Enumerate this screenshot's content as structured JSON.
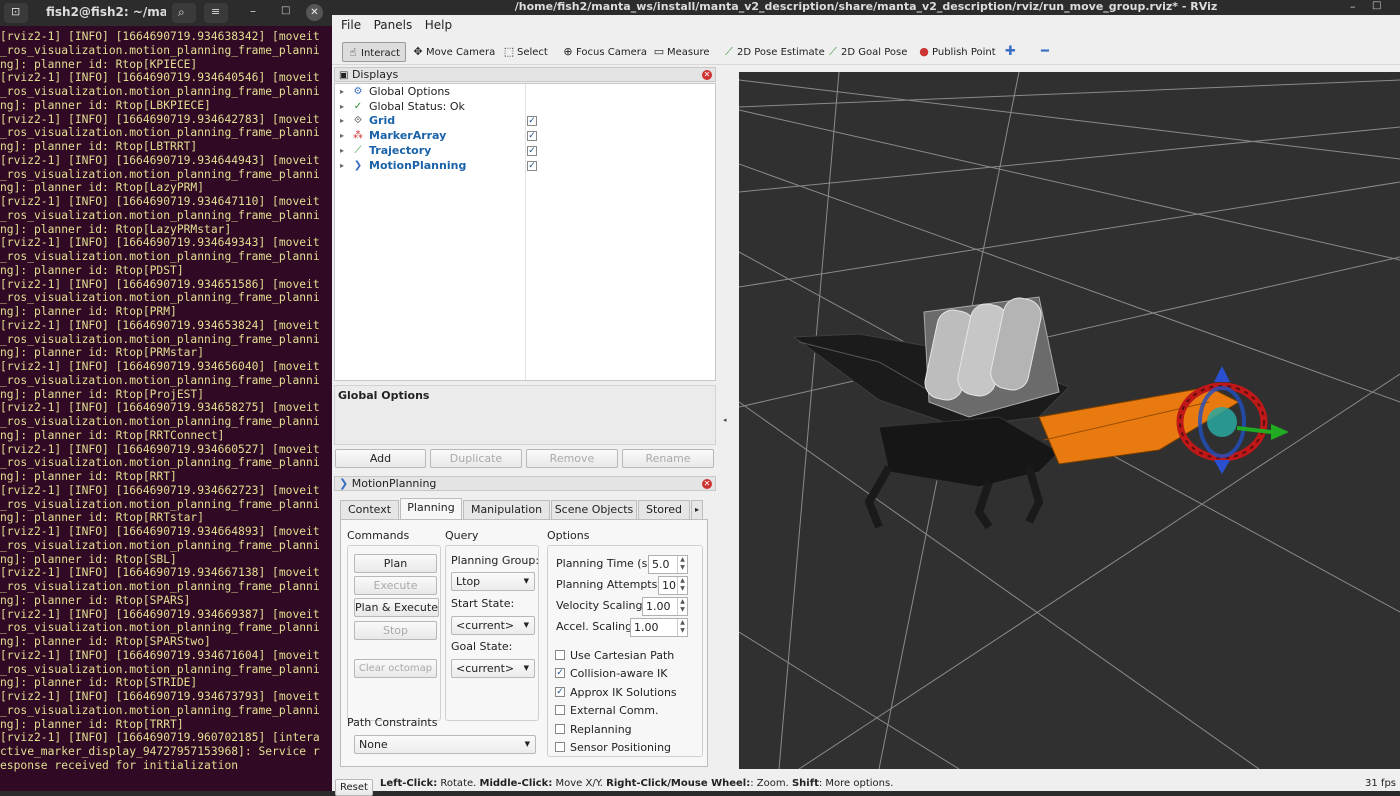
{
  "terminal": {
    "title": "fish2@fish2: ~/ma...",
    "lines": [
      "[rviz2-1] [INFO] [1664690719.934638342] [moveit",
      "_ros_visualization.motion_planning_frame_planni",
      "ng]: planner id: Rtop[KPIECE]",
      "[rviz2-1] [INFO] [1664690719.934640546] [moveit",
      "_ros_visualization.motion_planning_frame_planni",
      "ng]: planner id: Rtop[LBKPIECE]",
      "[rviz2-1] [INFO] [1664690719.934642783] [moveit",
      "_ros_visualization.motion_planning_frame_planni",
      "ng]: planner id: Rtop[LBTRRT]",
      "[rviz2-1] [INFO] [1664690719.934644943] [moveit",
      "_ros_visualization.motion_planning_frame_planni",
      "ng]: planner id: Rtop[LazyPRM]",
      "[rviz2-1] [INFO] [1664690719.934647110] [moveit",
      "_ros_visualization.motion_planning_frame_planni",
      "ng]: planner id: Rtop[LazyPRMstar]",
      "[rviz2-1] [INFO] [1664690719.934649343] [moveit",
      "_ros_visualization.motion_planning_frame_planni",
      "ng]: planner id: Rtop[PDST]",
      "[rviz2-1] [INFO] [1664690719.934651586] [moveit",
      "_ros_visualization.motion_planning_frame_planni",
      "ng]: planner id: Rtop[PRM]",
      "[rviz2-1] [INFO] [1664690719.934653824] [moveit",
      "_ros_visualization.motion_planning_frame_planni",
      "ng]: planner id: Rtop[PRMstar]",
      "[rviz2-1] [INFO] [1664690719.934656040] [moveit",
      "_ros_visualization.motion_planning_frame_planni",
      "ng]: planner id: Rtop[ProjEST]",
      "[rviz2-1] [INFO] [1664690719.934658275] [moveit",
      "_ros_visualization.motion_planning_frame_planni",
      "ng]: planner id: Rtop[RRTConnect]",
      "[rviz2-1] [INFO] [1664690719.934660527] [moveit",
      "_ros_visualization.motion_planning_frame_planni",
      "ng]: planner id: Rtop[RRT]",
      "[rviz2-1] [INFO] [1664690719.934662723] [moveit",
      "_ros_visualization.motion_planning_frame_planni",
      "ng]: planner id: Rtop[RRTstar]",
      "[rviz2-1] [INFO] [1664690719.934664893] [moveit",
      "_ros_visualization.motion_planning_frame_planni",
      "ng]: planner id: Rtop[SBL]",
      "[rviz2-1] [INFO] [1664690719.934667138] [moveit",
      "_ros_visualization.motion_planning_frame_planni",
      "ng]: planner id: Rtop[SPARS]",
      "[rviz2-1] [INFO] [1664690719.934669387] [moveit",
      "_ros_visualization.motion_planning_frame_planni",
      "ng]: planner id: Rtop[SPARStwo]",
      "[rviz2-1] [INFO] [1664690719.934671604] [moveit",
      "_ros_visualization.motion_planning_frame_planni",
      "ng]: planner id: Rtop[STRIDE]",
      "[rviz2-1] [INFO] [1664690719.934673793] [moveit",
      "_ros_visualization.motion_planning_frame_planni",
      "ng]: planner id: Rtop[TRRT]",
      "[rviz2-1] [INFO] [1664690719.960702185] [intera",
      "ctive_marker_display_94727957153968]: Service r",
      "esponse received for initialization"
    ]
  },
  "window": {
    "title": "/home/fish2/manta_ws/install/manta_v2_description/share/manta_v2_description/rviz/run_move_group.rviz* - RViz"
  },
  "menu": [
    "File",
    "Panels",
    "Help"
  ],
  "toolbar": [
    {
      "label": "Interact",
      "icon": "hand-cursor-icon"
    },
    {
      "label": "Move Camera",
      "icon": "move-camera-icon"
    },
    {
      "label": "Select",
      "icon": "select-icon"
    },
    {
      "label": "Focus Camera",
      "icon": "focus-camera-icon"
    },
    {
      "label": "Measure",
      "icon": "ruler-icon"
    },
    {
      "label": "2D Pose Estimate",
      "icon": "pose-estimate-arrow-icon"
    },
    {
      "label": "2D Goal Pose",
      "icon": "goal-pose-arrow-icon"
    },
    {
      "label": "Publish Point",
      "icon": "map-pin-icon"
    }
  ],
  "displays": {
    "title": "Displays",
    "items": [
      {
        "label": "Global Options",
        "icon": "gear-icon",
        "checked": null
      },
      {
        "label": "Global Status: Ok",
        "icon": "checkmark-icon",
        "checked": null
      },
      {
        "label": "Grid",
        "icon": "grid-icon",
        "checked": true
      },
      {
        "label": "MarkerArray",
        "icon": "marker-array-icon",
        "checked": true
      },
      {
        "label": "Trajectory",
        "icon": "trajectory-icon",
        "checked": true
      },
      {
        "label": "MotionPlanning",
        "icon": "motion-planning-icon",
        "checked": true
      }
    ],
    "description_title": "Global Options",
    "buttons": [
      "Add",
      "Duplicate",
      "Remove",
      "Rename"
    ]
  },
  "motion_planning": {
    "title": "MotionPlanning",
    "tabs": [
      "Context",
      "Planning",
      "Manipulation",
      "Scene Objects",
      "Stored"
    ],
    "selected_tab": "Planning",
    "commands": {
      "heading": "Commands",
      "plan": "Plan",
      "execute": "Execute",
      "plan_execute": "Plan & Execute",
      "stop": "Stop",
      "clear_octomap": "Clear octomap"
    },
    "query": {
      "heading": "Query",
      "planning_group_label": "Planning Group:",
      "planning_group_value": "Ltop",
      "start_state_label": "Start State:",
      "start_state_value": "<current>",
      "goal_state_label": "Goal State:",
      "goal_state_value": "<current>"
    },
    "options": {
      "heading": "Options",
      "planning_time_label": "Planning Time (s):",
      "planning_time_value": "5.0",
      "planning_attempts_label": "Planning Attempts:",
      "planning_attempts_value": "10",
      "velocity_scaling_label": "Velocity Scaling:",
      "velocity_scaling_value": "1.00",
      "accel_scaling_label": "Accel. Scaling:",
      "accel_scaling_value": "1.00",
      "checks": [
        {
          "label": "Use Cartesian Path",
          "checked": false
        },
        {
          "label": "Collision-aware IK",
          "checked": true
        },
        {
          "label": "Approx IK Solutions",
          "checked": true
        },
        {
          "label": "External Comm.",
          "checked": false
        },
        {
          "label": "Replanning",
          "checked": false
        },
        {
          "label": "Sensor Positioning",
          "checked": false
        }
      ]
    },
    "path_constraints": {
      "label": "Path Constraints",
      "value": "None"
    }
  },
  "status": {
    "reset": "Reset",
    "left_click": "Left-Click:",
    "left_click_desc": " Rotate. ",
    "middle_click": "Middle-Click:",
    "middle_click_desc": " Move X/Y. ",
    "right_click": "Right-Click/Mouse Wheel:",
    "right_click_desc": ": Zoom. ",
    "shift": "Shift",
    "shift_desc": ": More options.",
    "fps": "31 fps"
  },
  "colors": {
    "terminal_bg": "#300a24",
    "terminal_text": "#e3df93",
    "viewport_bg": "#303030",
    "robot_orange": "#e87a10"
  }
}
